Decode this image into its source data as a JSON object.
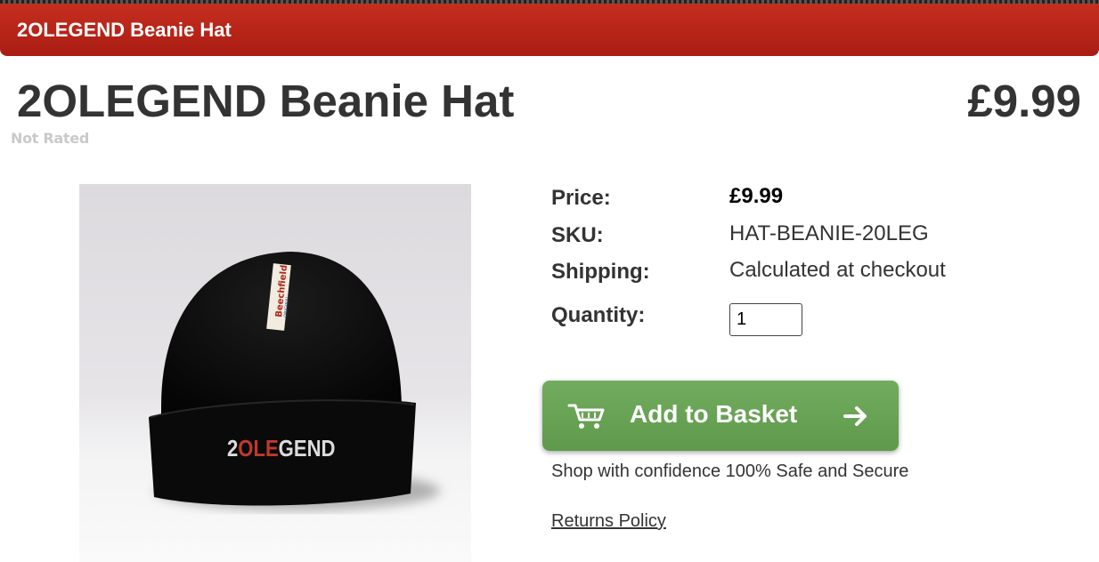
{
  "header": {
    "bar_title": "2OLEGEND Beanie Hat",
    "product_title": "2OLEGEND Beanie Hat",
    "price": "£9.99",
    "rating": "Not Rated"
  },
  "product_image": {
    "brand_tag": "Beechfield",
    "brand_tag_sub": "ORIGINAL",
    "embroidery_left": "2",
    "embroidery_red": "OLE",
    "embroidery_right": "GEND"
  },
  "details": {
    "price_label": "Price:",
    "price_value": "£9.99",
    "sku_label": "SKU:",
    "sku_value": "HAT-BEANIE-20LEG",
    "shipping_label": "Shipping:",
    "shipping_value": "Calculated at checkout",
    "quantity_label": "Quantity:",
    "quantity_value": "1"
  },
  "actions": {
    "add_to_basket_label": "Add to Basket",
    "confidence_text": "Shop with confidence 100% Safe and Secure",
    "returns_link": "Returns Policy"
  },
  "colors": {
    "header_bar": "#b8251a",
    "button_green": "#68a355",
    "text": "#333333"
  },
  "icons": [
    "cart-icon",
    "arrow-right-icon"
  ]
}
